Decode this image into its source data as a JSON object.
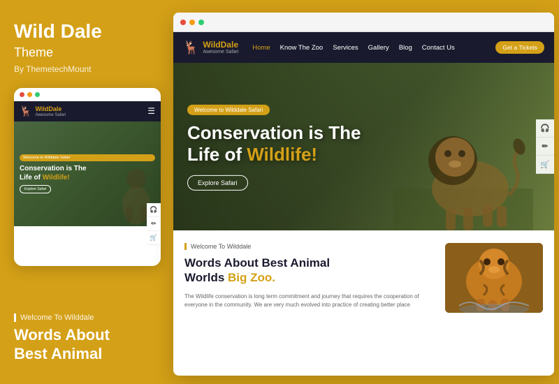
{
  "left": {
    "title_part1": "Wild ",
    "title_part2": "Dale",
    "subtitle": "Theme",
    "author": "By ThemetechMount",
    "mobile_preview": {
      "dots_colors": [
        "#e74c3c",
        "#f39c12",
        "#2ecc71"
      ],
      "nav": {
        "logo_bold": "Wild",
        "logo_light": "Dale",
        "logo_sub": "Awesome Safari"
      },
      "hero": {
        "badge": "Welcome to Wilddale Safari",
        "title_line1": "Conservation is The",
        "title_line2": "Life of ",
        "title_highlight": "Wildlife!",
        "explore_btn": "Explore Safari"
      }
    },
    "bottom": {
      "welcome": "Welcome To Wilddale",
      "title": "Words About\nBest Animal"
    }
  },
  "right": {
    "browser_dots": [
      "#e74c3c",
      "#f39c12",
      "#2ecc71"
    ],
    "nav": {
      "logo_bold": "Wild",
      "logo_light": "Dale",
      "logo_sub": "Awesome Safari",
      "links": [
        "Home",
        "Know The Zoo",
        "Services",
        "Gallery",
        "Blog",
        "Contact Us"
      ],
      "active_link": "Home",
      "ticket_btn": "Get a Tickets"
    },
    "hero": {
      "badge": "Welcome to Wilddale Safari",
      "title_line1": "Conservation is The",
      "title_line2": "Life of ",
      "title_highlight": "Wildlife!",
      "explore_btn": "Explore Safari"
    },
    "content": {
      "welcome_label": "Welcome To Wilddale",
      "title": "Words About Best Animal\nWorlds ",
      "title_highlight": "Big Zoo.",
      "description": "The Wildlife conservation is long term commitment and journey that requires the cooperation of everyone in the community. We are very much evolved into practice of creating better place"
    }
  },
  "accent_color": "#D4A017",
  "icons": {
    "headphone": "🎧",
    "pencil": "✏",
    "cart": "🛒",
    "deer": "🦌"
  }
}
